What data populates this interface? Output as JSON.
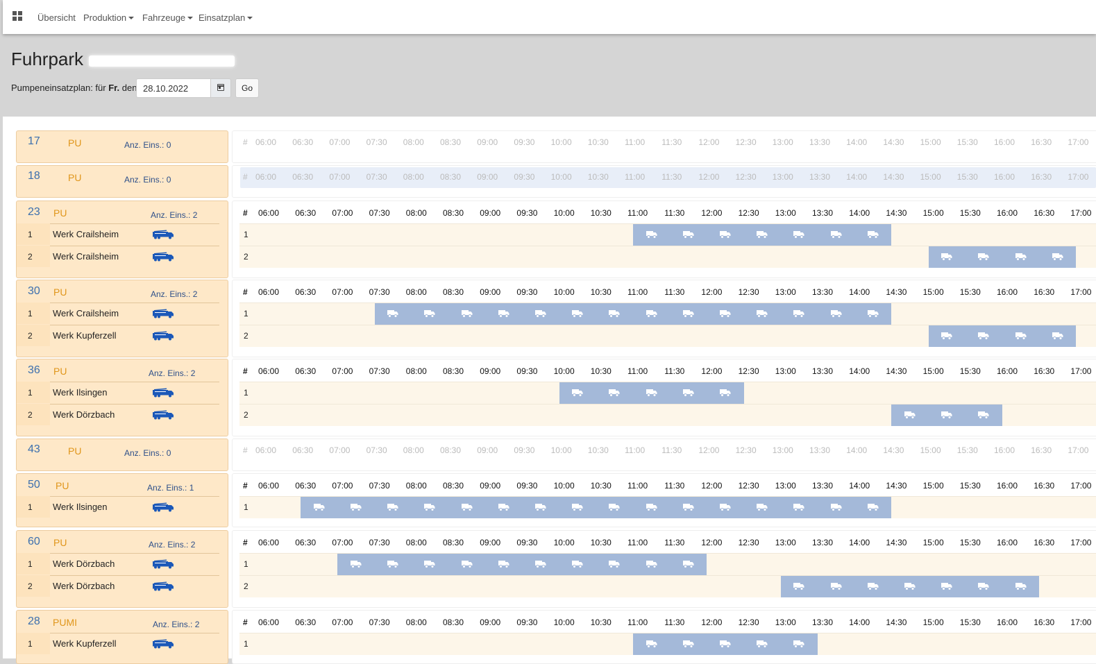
{
  "nav": {
    "items": [
      {
        "label": "Übersicht",
        "dropdown": false
      },
      {
        "label": "Produktion",
        "dropdown": true
      },
      {
        "label": "Fahrzeuge",
        "dropdown": true
      },
      {
        "label": "Einsatzplan",
        "dropdown": true
      }
    ]
  },
  "page": {
    "title": "Fuhrpark",
    "date_label_prefix": "Pumpeneinsatzplan: für",
    "date_label_day": "Fr.",
    "date_label_suffix": "den:",
    "date_value": "28.10.2022",
    "go_label": "Go"
  },
  "colors": {
    "bar": "#a4b9d9",
    "truck_blue": "#1b58b8",
    "vehicle_bg": "#fee8c8",
    "vehicle_number": "#3b6fae",
    "vehicle_type": "#e0961b"
  },
  "icons": {
    "nav": "grid-icon",
    "calendar": "calendar-icon",
    "truck": "truck-icon",
    "vehicle_truck": "concrete-pump-truck-icon"
  },
  "schedule": {
    "hash_label": "#",
    "times": [
      "06:00",
      "06:30",
      "07:00",
      "07:30",
      "08:00",
      "08:30",
      "09:00",
      "09:30",
      "10:00",
      "10:30",
      "11:00",
      "11:30",
      "12:00",
      "12:30",
      "13:00",
      "13:30",
      "14:00",
      "14:30",
      "15:00",
      "15:30",
      "16:00",
      "16:30",
      "17:00"
    ]
  },
  "vehicles": [
    {
      "number": "17",
      "type": "PU",
      "count_label": "Anz. Eins.: 0",
      "jobs": []
    },
    {
      "number": "18",
      "type": "PU",
      "count_label": "Anz. Eins.: 0",
      "jobs": []
    },
    {
      "number": "23",
      "type": "PU",
      "count_label": "Anz. Eins.: 2",
      "jobs": [
        {
          "num": "1",
          "label": "Werk Crailsheim",
          "start": "11:00",
          "end": "14:30"
        },
        {
          "num": "2",
          "label": "Werk Crailsheim",
          "start": "15:00",
          "end": "17:00"
        }
      ]
    },
    {
      "number": "30",
      "type": "PU",
      "count_label": "Anz. Eins.: 2",
      "jobs": [
        {
          "num": "1",
          "label": "Werk Crailsheim",
          "start": "07:30",
          "end": "14:30"
        },
        {
          "num": "2",
          "label": "Werk Kupferzell",
          "start": "15:00",
          "end": "17:00"
        }
      ]
    },
    {
      "number": "36",
      "type": "PU",
      "count_label": "Anz. Eins.: 2",
      "jobs": [
        {
          "num": "1",
          "label": "Werk Ilsingen",
          "start": "10:00",
          "end": "12:30"
        },
        {
          "num": "2",
          "label": "Werk Dörzbach",
          "start": "14:30",
          "end": "16:00"
        }
      ]
    },
    {
      "number": "43",
      "type": "PU",
      "count_label": "Anz. Eins.: 0",
      "jobs": []
    },
    {
      "number": "50",
      "type": "PU",
      "count_label": "Anz. Eins.: 1",
      "jobs": [
        {
          "num": "1",
          "label": "Werk Ilsingen",
          "start": "06:30",
          "end": "14:30"
        }
      ]
    },
    {
      "number": "60",
      "type": "PU",
      "count_label": "Anz. Eins.: 2",
      "jobs": [
        {
          "num": "1",
          "label": "Werk Dörzbach",
          "start": "07:00",
          "end": "12:00"
        },
        {
          "num": "2",
          "label": "Werk Dörzbach",
          "start": "13:00",
          "end": "16:30"
        }
      ]
    },
    {
      "number": "28",
      "type": "PUMI",
      "count_label": "Anz. Eins.: 2",
      "jobs": [
        {
          "num": "1",
          "label": "Werk Kupferzell",
          "start": "11:00",
          "end": "13:30"
        }
      ]
    }
  ]
}
